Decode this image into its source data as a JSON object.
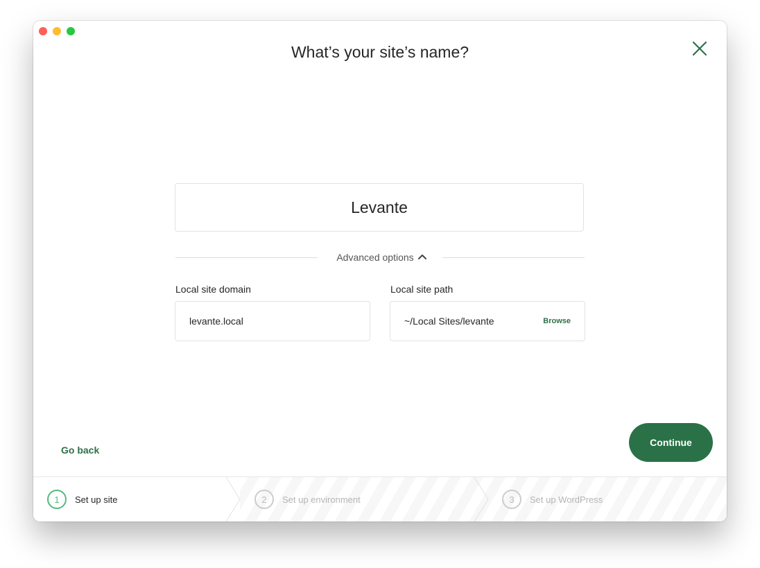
{
  "dialog": {
    "title": "What’s your site’s name?",
    "close_icon": "close-icon"
  },
  "site_name": {
    "value": "Levante"
  },
  "advanced": {
    "label": "Advanced options",
    "expanded": true,
    "toggle_icon": "chevron-up-icon"
  },
  "domain": {
    "label": "Local site domain",
    "value": "levante.local"
  },
  "path": {
    "label": "Local site path",
    "value": "~/Local Sites/levante",
    "browse_label": "Browse"
  },
  "actions": {
    "go_back_label": "Go back",
    "continue_label": "Continue"
  },
  "steps": [
    {
      "number": "1",
      "label": "Set up site",
      "active": true
    },
    {
      "number": "2",
      "label": "Set up environment",
      "active": false
    },
    {
      "number": "3",
      "label": "Set up WordPress",
      "active": false
    }
  ],
  "colors": {
    "accent": "#2a7147",
    "step_active": "#51bb7b",
    "text": "#262626"
  }
}
